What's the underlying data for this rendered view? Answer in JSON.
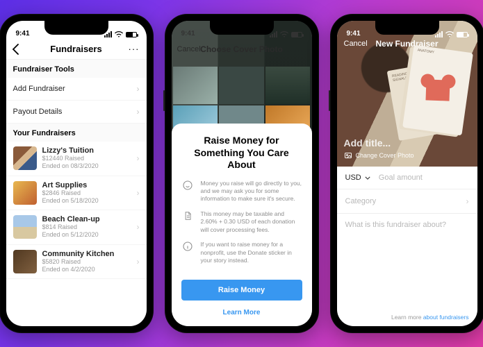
{
  "status": {
    "time": "9:41"
  },
  "phone1": {
    "nav": {
      "title": "Fundraisers",
      "more": "···"
    },
    "sections": {
      "tools_header": "Fundraiser Tools",
      "tool_rows": [
        "Add Fundraiser",
        "Payout Details"
      ],
      "your_header": "Your Fundraisers"
    },
    "fundraisers": [
      {
        "name": "Lizzy's Tuition",
        "raised": "$12440 Raised",
        "ended": "Ended on 08/3/2020"
      },
      {
        "name": "Art Supplies",
        "raised": "$2846 Raised",
        "ended": "Ended on 5/18/2020"
      },
      {
        "name": "Beach Clean-up",
        "raised": "$814 Raised",
        "ended": "Ended on 5/12/2020"
      },
      {
        "name": "Community Kitchen",
        "raised": "$5820 Raised",
        "ended": "Ended on 4/2/2020"
      }
    ]
  },
  "phone2": {
    "nav": {
      "cancel": "Cancel",
      "title": "Choose Cover Photo"
    },
    "sheet": {
      "heading": "Raise Money for Something You Care About",
      "bullets": [
        "Money you raise will go directly to you, and we may ask you for some information to make sure it's secure.",
        "This money may be taxable and 2.60% + 0.30 USD of each donation will cover processing fees.",
        "If you want to raise money for a nonprofit, use the Donate sticker in your story instead."
      ],
      "primary": "Raise Money",
      "secondary": "Learn More"
    }
  },
  "phone3": {
    "nav": {
      "cancel": "Cancel",
      "title": "New Fundraiser"
    },
    "hero": {
      "add_title_placeholder": "Add title...",
      "change_cover": "Change Cover Photo",
      "poster_text": "READING THE SIGNALS",
      "poster_text2": "ANATOMY"
    },
    "form": {
      "currency": "USD",
      "goal_placeholder": "Goal amount",
      "category_placeholder": "Category",
      "about_placeholder": "What is this fundraiser about?"
    },
    "learn": {
      "prefix": "Learn more ",
      "link": "about fundraisers"
    }
  }
}
